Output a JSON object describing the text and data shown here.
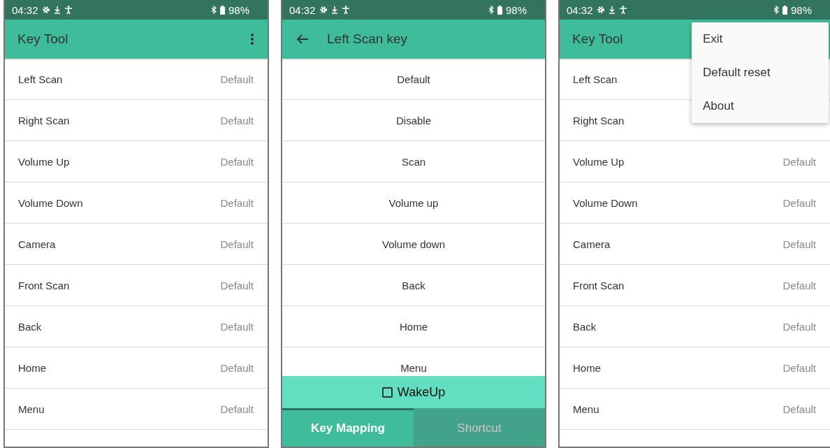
{
  "screens": [
    {
      "kind": "list",
      "status": {
        "time": "04:32",
        "battery": "98%"
      },
      "app_bar": {
        "title": "Key Tool"
      },
      "rows": [
        {
          "name": "Left Scan",
          "value": "Default"
        },
        {
          "name": "Right Scan",
          "value": "Default"
        },
        {
          "name": "Volume Up",
          "value": "Default"
        },
        {
          "name": "Volume Down",
          "value": "Default"
        },
        {
          "name": "Camera",
          "value": "Default"
        },
        {
          "name": "Front Scan",
          "value": "Default"
        },
        {
          "name": "Back",
          "value": "Default"
        },
        {
          "name": "Home",
          "value": "Default"
        },
        {
          "name": "Menu",
          "value": "Default"
        }
      ]
    },
    {
      "kind": "options",
      "status": {
        "time": "04:32",
        "battery": "98%"
      },
      "app_bar": {
        "title": "Left Scan key"
      },
      "options": [
        "Default",
        "Disable",
        "Scan",
        "Volume up",
        "Volume down",
        "Back",
        "Home",
        "Menu"
      ],
      "wakeup": {
        "label": "WakeUp",
        "checked": false
      },
      "tabs": [
        {
          "label": "Key Mapping",
          "selected": true
        },
        {
          "label": "Shortcut",
          "selected": false
        }
      ]
    },
    {
      "kind": "list",
      "status": {
        "time": "04:32",
        "battery": "98%"
      },
      "app_bar": {
        "title": "Key Tool"
      },
      "rows": [
        {
          "name": "Left Scan"
        },
        {
          "name": "Right Scan"
        },
        {
          "name": "Volume Up",
          "value": "Default"
        },
        {
          "name": "Volume Down",
          "value": "Default"
        },
        {
          "name": "Camera",
          "value": "Default"
        },
        {
          "name": "Front Scan",
          "value": "Default"
        },
        {
          "name": "Back",
          "value": "Default"
        },
        {
          "name": "Home",
          "value": "Default"
        },
        {
          "name": "Menu",
          "value": "Default"
        }
      ],
      "menu": {
        "items": [
          "Exit",
          "Default reset",
          "About"
        ]
      }
    }
  ]
}
